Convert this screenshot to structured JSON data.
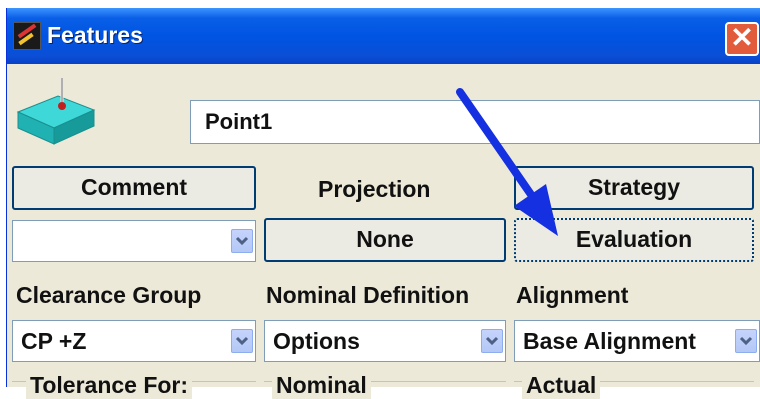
{
  "window": {
    "title": "Features",
    "close_glyph": "✕",
    "app_icon": "pcdmis-logo-icon",
    "close_icon": "close-icon"
  },
  "feature": {
    "icon": "point-feature-icon",
    "name": "Point1"
  },
  "buttons": {
    "comment": "Comment",
    "strategy": "Strategy",
    "none": "None",
    "evaluation": "Evaluation"
  },
  "labels": {
    "projection": "Projection",
    "clearance_group": "Clearance Group",
    "nominal_definition": "Nominal Definition",
    "alignment": "Alignment",
    "tolerance_for": "Tolerance For:",
    "nominal": "Nominal",
    "actual": "Actual"
  },
  "combos": {
    "comment_value": "",
    "clearance_value": "CP +Z",
    "nominal_value": "Options",
    "alignment_value": "Base Alignment"
  },
  "annotation": {
    "arrow_color": "#1530e0",
    "arrow_icon": "callout-arrow"
  },
  "colors": {
    "titlebar": "#0054e3",
    "dialog_bg": "#ece9d8",
    "close": "#e25b3a"
  }
}
